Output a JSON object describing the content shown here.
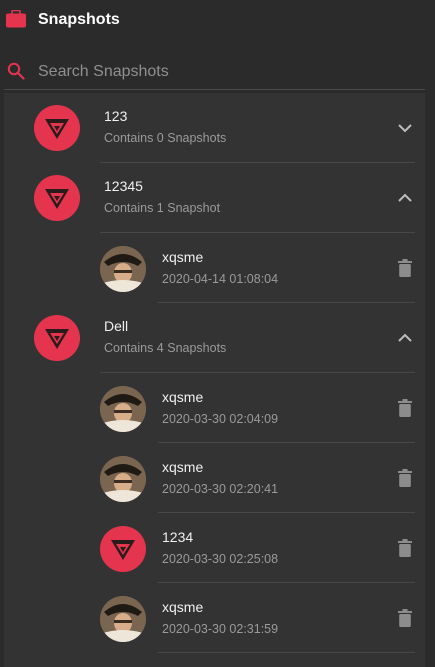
{
  "header": {
    "title": "Snapshots",
    "icon": "briefcase-icon",
    "icon_color": "#e5354e"
  },
  "search": {
    "placeholder": "Search Snapshots",
    "value": "",
    "icon": "search-icon"
  },
  "accent_color": "#e5354e",
  "groups": [
    {
      "name": "123",
      "count_text": "Contains 0 Snapshots",
      "expanded": false,
      "snapshots": []
    },
    {
      "name": "12345",
      "count_text": "Contains 1 Snapshot",
      "expanded": true,
      "snapshots": [
        {
          "name": "xqsme",
          "timestamp": "2020-04-14 01:08:04",
          "avatar": "photo"
        }
      ]
    },
    {
      "name": "Dell",
      "count_text": "Contains 4 Snapshots",
      "expanded": true,
      "snapshots": [
        {
          "name": "xqsme",
          "timestamp": "2020-03-30 02:04:09",
          "avatar": "photo"
        },
        {
          "name": "xqsme",
          "timestamp": "2020-03-30 02:20:41",
          "avatar": "photo"
        },
        {
          "name": "1234",
          "timestamp": "2020-03-30 02:25:08",
          "avatar": "logo"
        },
        {
          "name": "xqsme",
          "timestamp": "2020-03-30 02:31:59",
          "avatar": "photo"
        }
      ]
    }
  ]
}
